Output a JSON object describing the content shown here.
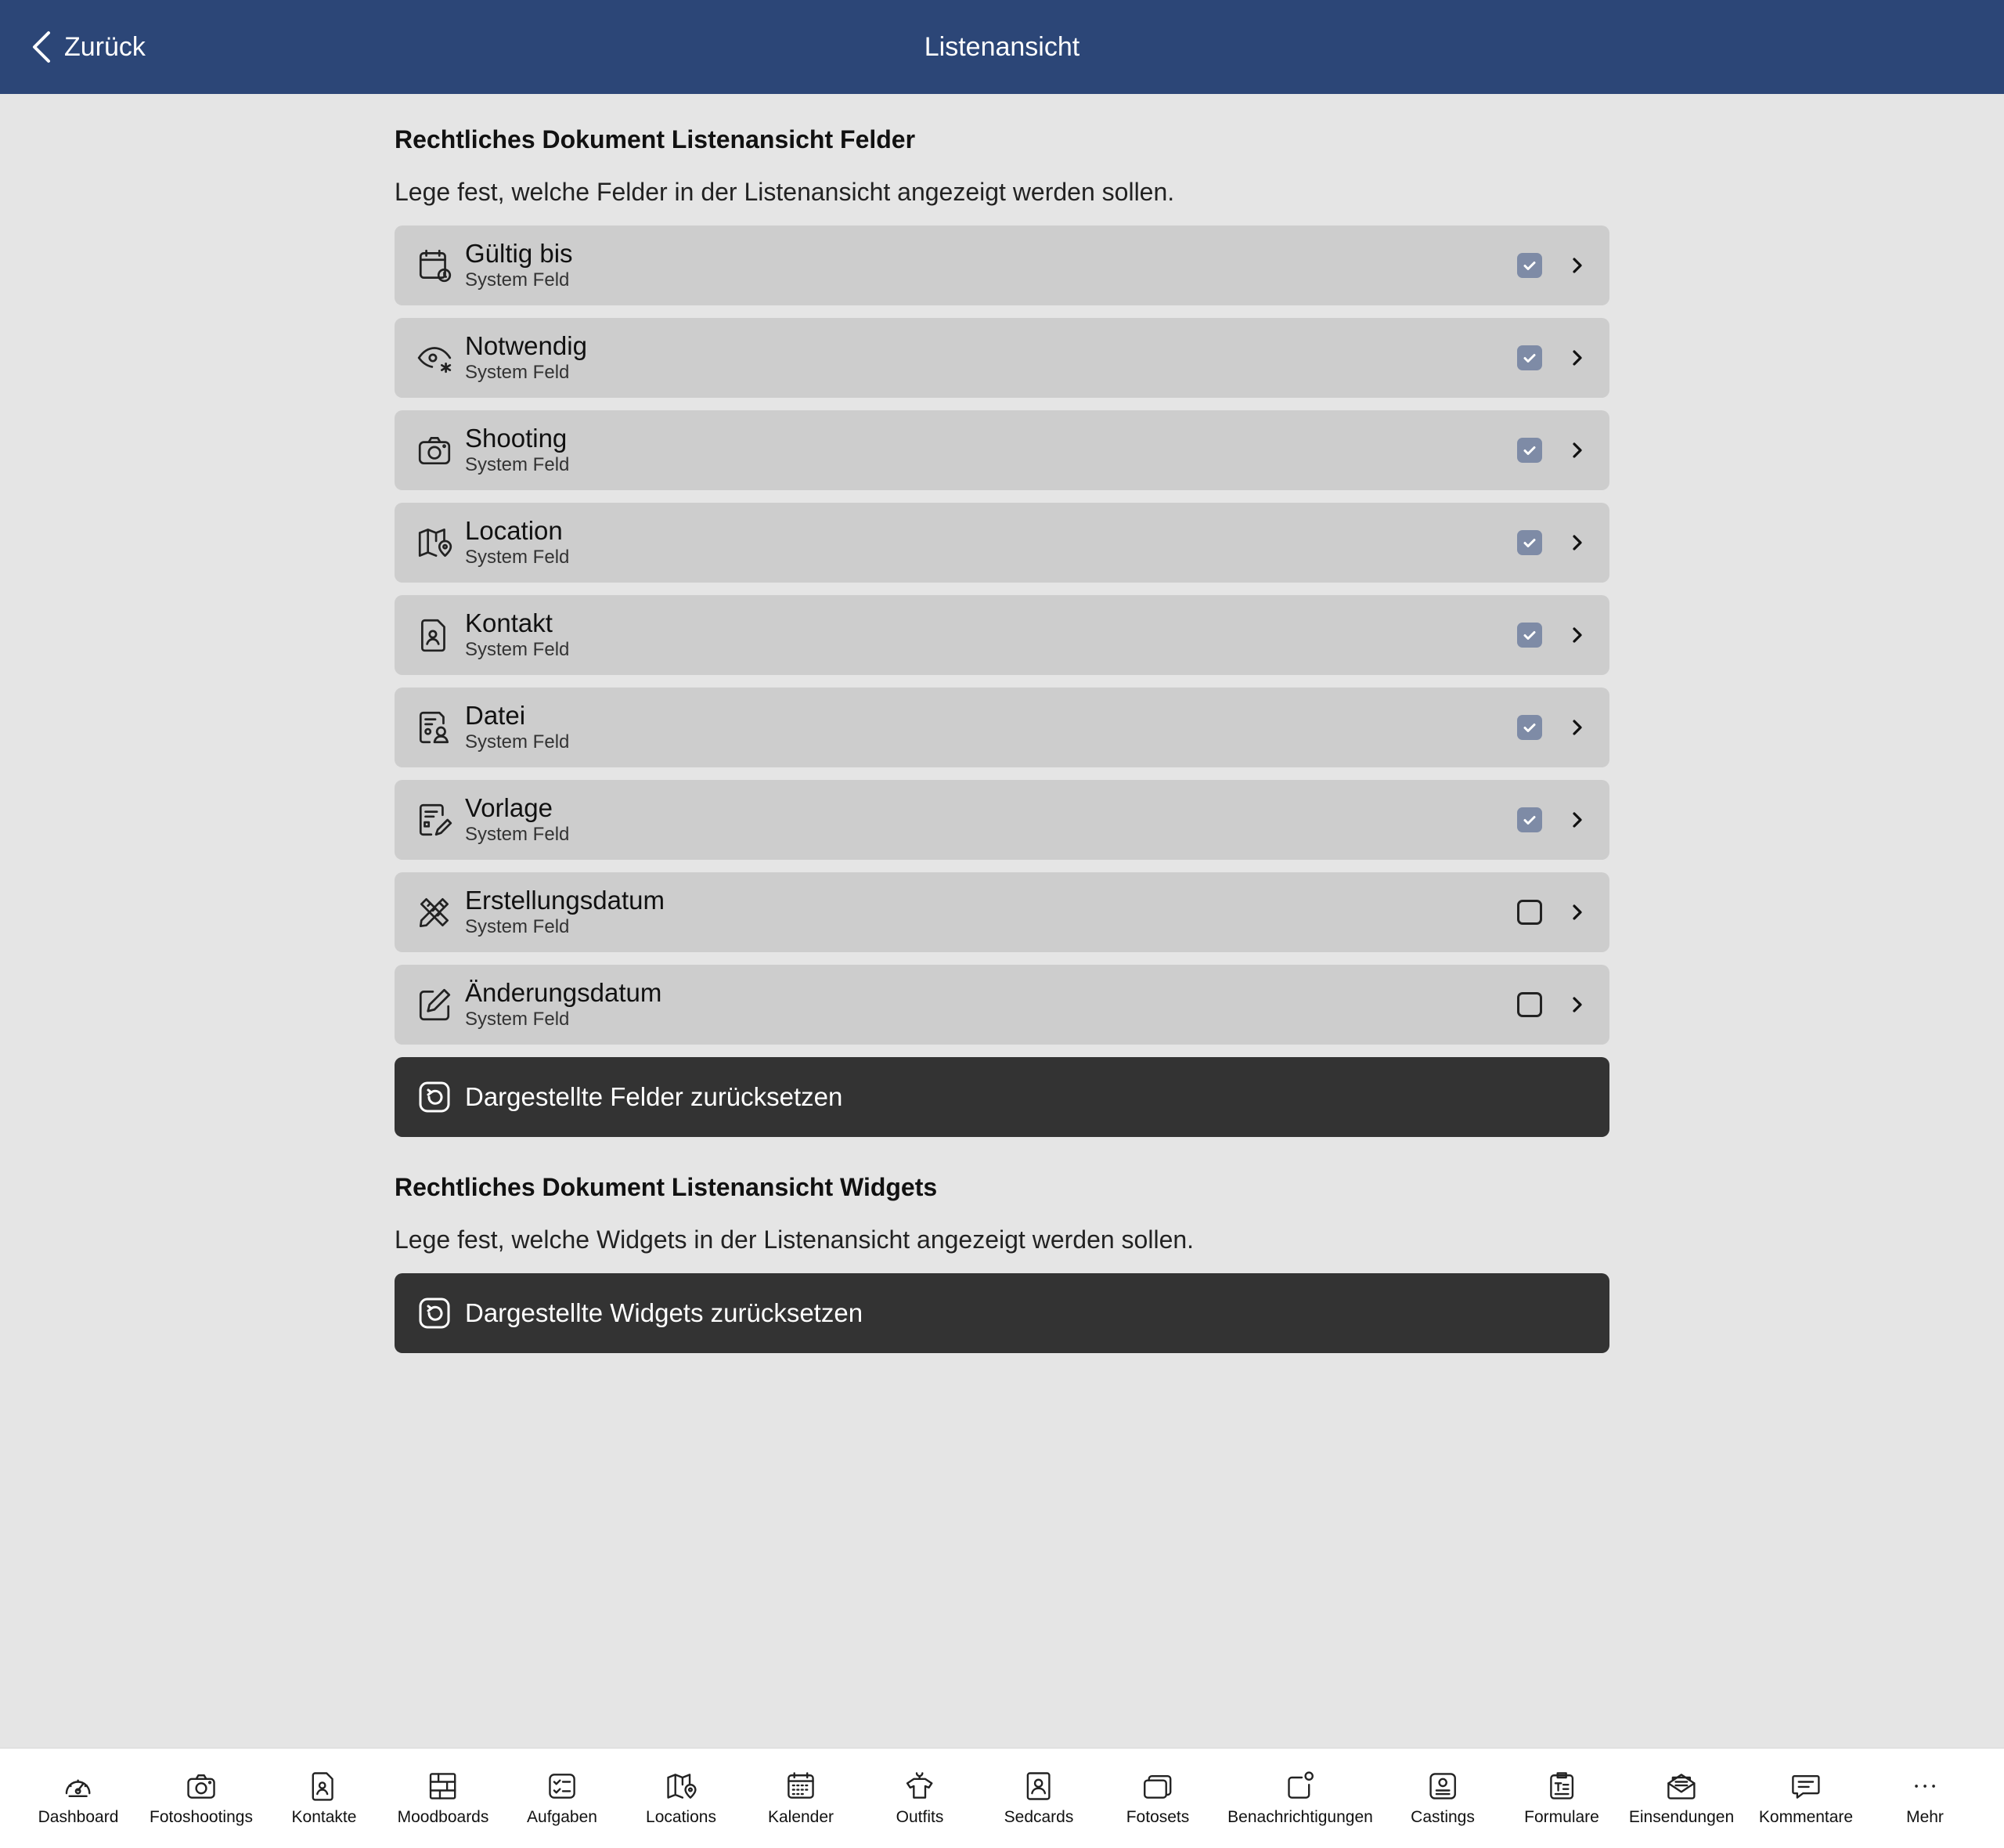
{
  "header": {
    "back_label": "Zurück",
    "title": "Listenansicht",
    "background": "#2c4677"
  },
  "fields_section": {
    "title": "Rechtliches Dokument Listenansicht Felder",
    "description": "Lege fest, welche Felder in der Listenansicht angezeigt werden sollen.",
    "items": [
      {
        "name": "Gültig bis",
        "subtitle": "System Feld",
        "checked": true,
        "icon": "calendar-clock-icon"
      },
      {
        "name": "Notwendig",
        "subtitle": "System Feld",
        "checked": true,
        "icon": "eye-asterisk-icon"
      },
      {
        "name": "Shooting",
        "subtitle": "System Feld",
        "checked": true,
        "icon": "camera-icon"
      },
      {
        "name": "Location",
        "subtitle": "System Feld",
        "checked": true,
        "icon": "map-pin-icon"
      },
      {
        "name": "Kontakt",
        "subtitle": "System Feld",
        "checked": true,
        "icon": "contact-card-icon"
      },
      {
        "name": "Datei",
        "subtitle": "System Feld",
        "checked": true,
        "icon": "file-user-icon"
      },
      {
        "name": "Vorlage",
        "subtitle": "System Feld",
        "checked": true,
        "icon": "template-edit-icon"
      },
      {
        "name": "Erstellungsdatum",
        "subtitle": "System Feld",
        "checked": false,
        "icon": "pencil-ruler-icon"
      },
      {
        "name": "Änderungsdatum",
        "subtitle": "System Feld",
        "checked": false,
        "icon": "edit-square-icon"
      }
    ],
    "reset_label": "Dargestellte Felder zurücksetzen"
  },
  "widgets_section": {
    "title": "Rechtliches Dokument Listenansicht Widgets",
    "description": "Lege fest, welche Widgets in der Listenansicht angezeigt werden sollen.",
    "reset_label": "Dargestellte Widgets zurücksetzen"
  },
  "tabbar": {
    "items": [
      {
        "label": "Dashboard",
        "icon": "dashboard-icon"
      },
      {
        "label": "Fotoshootings",
        "icon": "camera-icon"
      },
      {
        "label": "Kontakte",
        "icon": "contact-card-icon"
      },
      {
        "label": "Moodboards",
        "icon": "moodboard-icon"
      },
      {
        "label": "Aufgaben",
        "icon": "tasks-icon"
      },
      {
        "label": "Locations",
        "icon": "map-pin-icon"
      },
      {
        "label": "Kalender",
        "icon": "calendar-icon"
      },
      {
        "label": "Outfits",
        "icon": "outfit-icon"
      },
      {
        "label": "Sedcards",
        "icon": "sedcard-icon"
      },
      {
        "label": "Fotosets",
        "icon": "photosets-icon"
      },
      {
        "label": "Benachrichtigungen",
        "icon": "notification-icon"
      },
      {
        "label": "Castings",
        "icon": "casting-icon"
      },
      {
        "label": "Formulare",
        "icon": "form-icon"
      },
      {
        "label": "Einsendungen",
        "icon": "mail-open-icon"
      },
      {
        "label": "Kommentare",
        "icon": "comment-icon"
      },
      {
        "label": "Mehr",
        "icon": "more-icon"
      }
    ]
  },
  "colors": {
    "row_bg": "#cdcdcd",
    "checkbox_checked": "#7e8ba6",
    "reset_bg": "#333333",
    "page_bg": "#e5e5e5"
  }
}
